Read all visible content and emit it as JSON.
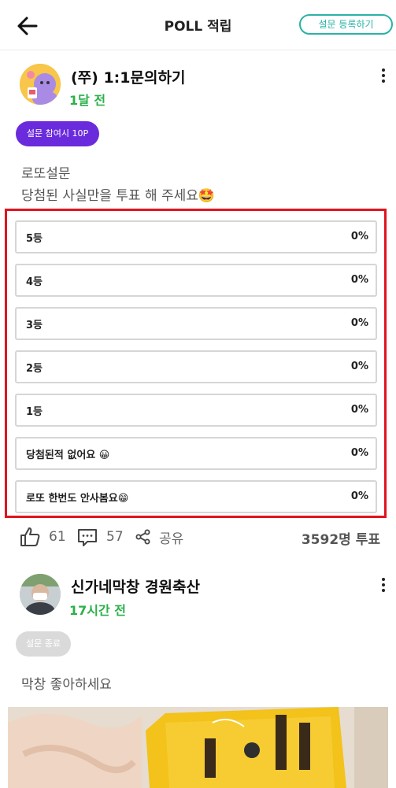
{
  "header": {
    "title": "POLL 적립",
    "register_label": "설문 등록하기"
  },
  "posts": [
    {
      "user_name": "(쭈) 1:1문의하기",
      "time_ago": "1달 전",
      "badge": "설문 참여시 10P",
      "body_lines": [
        "로또설문",
        "당첨된 사실만을 투표 해 주세요🤩"
      ],
      "poll_options": [
        {
          "label": "5등",
          "percent": "0%"
        },
        {
          "label": "4등",
          "percent": "0%"
        },
        {
          "label": "3등",
          "percent": "0%"
        },
        {
          "label": "2등",
          "percent": "0%"
        },
        {
          "label": "1등",
          "percent": "0%"
        },
        {
          "label": "당첨된적 없어요 😀",
          "percent": "0%"
        },
        {
          "label": "로또 한번도 안사봄요😁",
          "percent": "0%"
        }
      ],
      "likes": "61",
      "comments": "57",
      "share_label": "공유",
      "vote_count": "3592명 투표"
    },
    {
      "user_name": "신가네막창 경원축산",
      "time_ago": "17시간 전",
      "badge": "설문 종료",
      "body_lines": [
        "막창 좋아하세요"
      ]
    }
  ],
  "icons": {
    "back": "arrow-left-icon",
    "more": "more-vertical-icon",
    "like": "thumbs-up-icon",
    "comment": "comment-icon",
    "share": "share-icon"
  },
  "colors": {
    "accent_teal": "#2ab3a5",
    "time_green": "#2bb04a",
    "badge_purple": "#6a2bdc",
    "badge_gray": "#dadada",
    "highlight_red": "#e0141e"
  }
}
